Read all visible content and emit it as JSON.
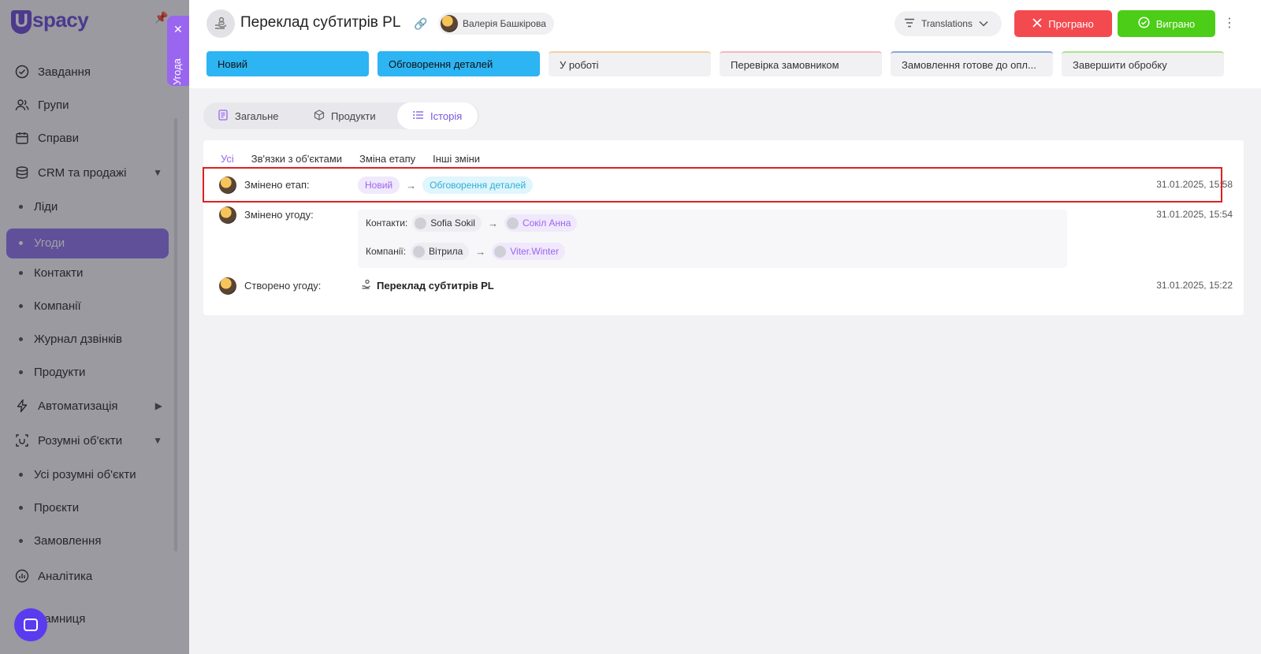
{
  "sidebar": {
    "logo_letter": "U",
    "logo_rest": "spacy",
    "items": [
      {
        "label": "Завдання",
        "icon": "check-circle-icon"
      },
      {
        "label": "Групи",
        "icon": "users-icon"
      },
      {
        "label": "Справи",
        "icon": "calendar-icon"
      },
      {
        "label": "CRM та продажі",
        "icon": "database-icon"
      },
      {
        "label": "Автоматизація",
        "icon": "bolt-icon"
      },
      {
        "label": "Розумні об'єкти",
        "icon": "smart-object-icon"
      },
      {
        "label": "Аналітика",
        "icon": "analytics-icon"
      },
      {
        "label": "рамниця",
        "icon": "none"
      }
    ],
    "crm_sub": [
      "Ліди",
      "Угоди",
      "Контакти",
      "Компанії",
      "Журнал дзвінків",
      "Продукти"
    ],
    "smart_sub": [
      "Усі розумні об'єкти",
      "Проєкти",
      "Замовлення"
    ],
    "active_sub": "Угоди"
  },
  "vertical_tab": {
    "label": "Угода"
  },
  "header": {
    "title": "Переклад субтитрів PL",
    "owner": "Валерія Башкірова",
    "pipeline": "Translations",
    "lost_label": "Програно",
    "won_label": "Виграно"
  },
  "stages": [
    {
      "label": "Новий",
      "state": "done",
      "color": "#2db4f3"
    },
    {
      "label": "Обговорення деталей",
      "state": "done",
      "color": "#2db4f3"
    },
    {
      "label": "У роботі",
      "state": "todo",
      "color": "#f5cfa0"
    },
    {
      "label": "Перевірка замовником",
      "state": "todo",
      "color": "#f2b8c0"
    },
    {
      "label": "Замовлення готове до опл...",
      "state": "todo",
      "color": "#8aa8d8"
    },
    {
      "label": "Завершити обробку",
      "state": "todo",
      "color": "#a8e58a"
    }
  ],
  "tabs": [
    {
      "label": "Загальне",
      "active": false
    },
    {
      "label": "Продукти",
      "active": false
    },
    {
      "label": "Історія",
      "active": true
    }
  ],
  "filters": [
    "Усі",
    "Зв'язки з об'єктами",
    "Зміна етапу",
    "Інші зміни"
  ],
  "history": {
    "stage_change": {
      "label": "Змінено етап:",
      "from": "Новий",
      "to": "Обговорення деталей",
      "date": "31.01.2025, 15:58"
    },
    "deal_change": {
      "label": "Змінено угоду:",
      "date": "31.01.2025, 15:54",
      "contacts_label": "Контакти:",
      "contacts_from": "Sofia Sokil",
      "contacts_to": "Сокіл Анна",
      "companies_label": "Компанії:",
      "companies_from": "Вітрила",
      "companies_to": "Viter.Winter"
    },
    "created": {
      "label": "Створено угоду:",
      "deal_name": "Переклад субтитрів PL",
      "date": "31.01.2025, 15:22"
    }
  },
  "colors": {
    "accent": "#9a66f0",
    "lost": "#f34a50",
    "won": "#4ccd17",
    "stage_done": "#2db4f3",
    "highlight": "#e01f1f"
  }
}
